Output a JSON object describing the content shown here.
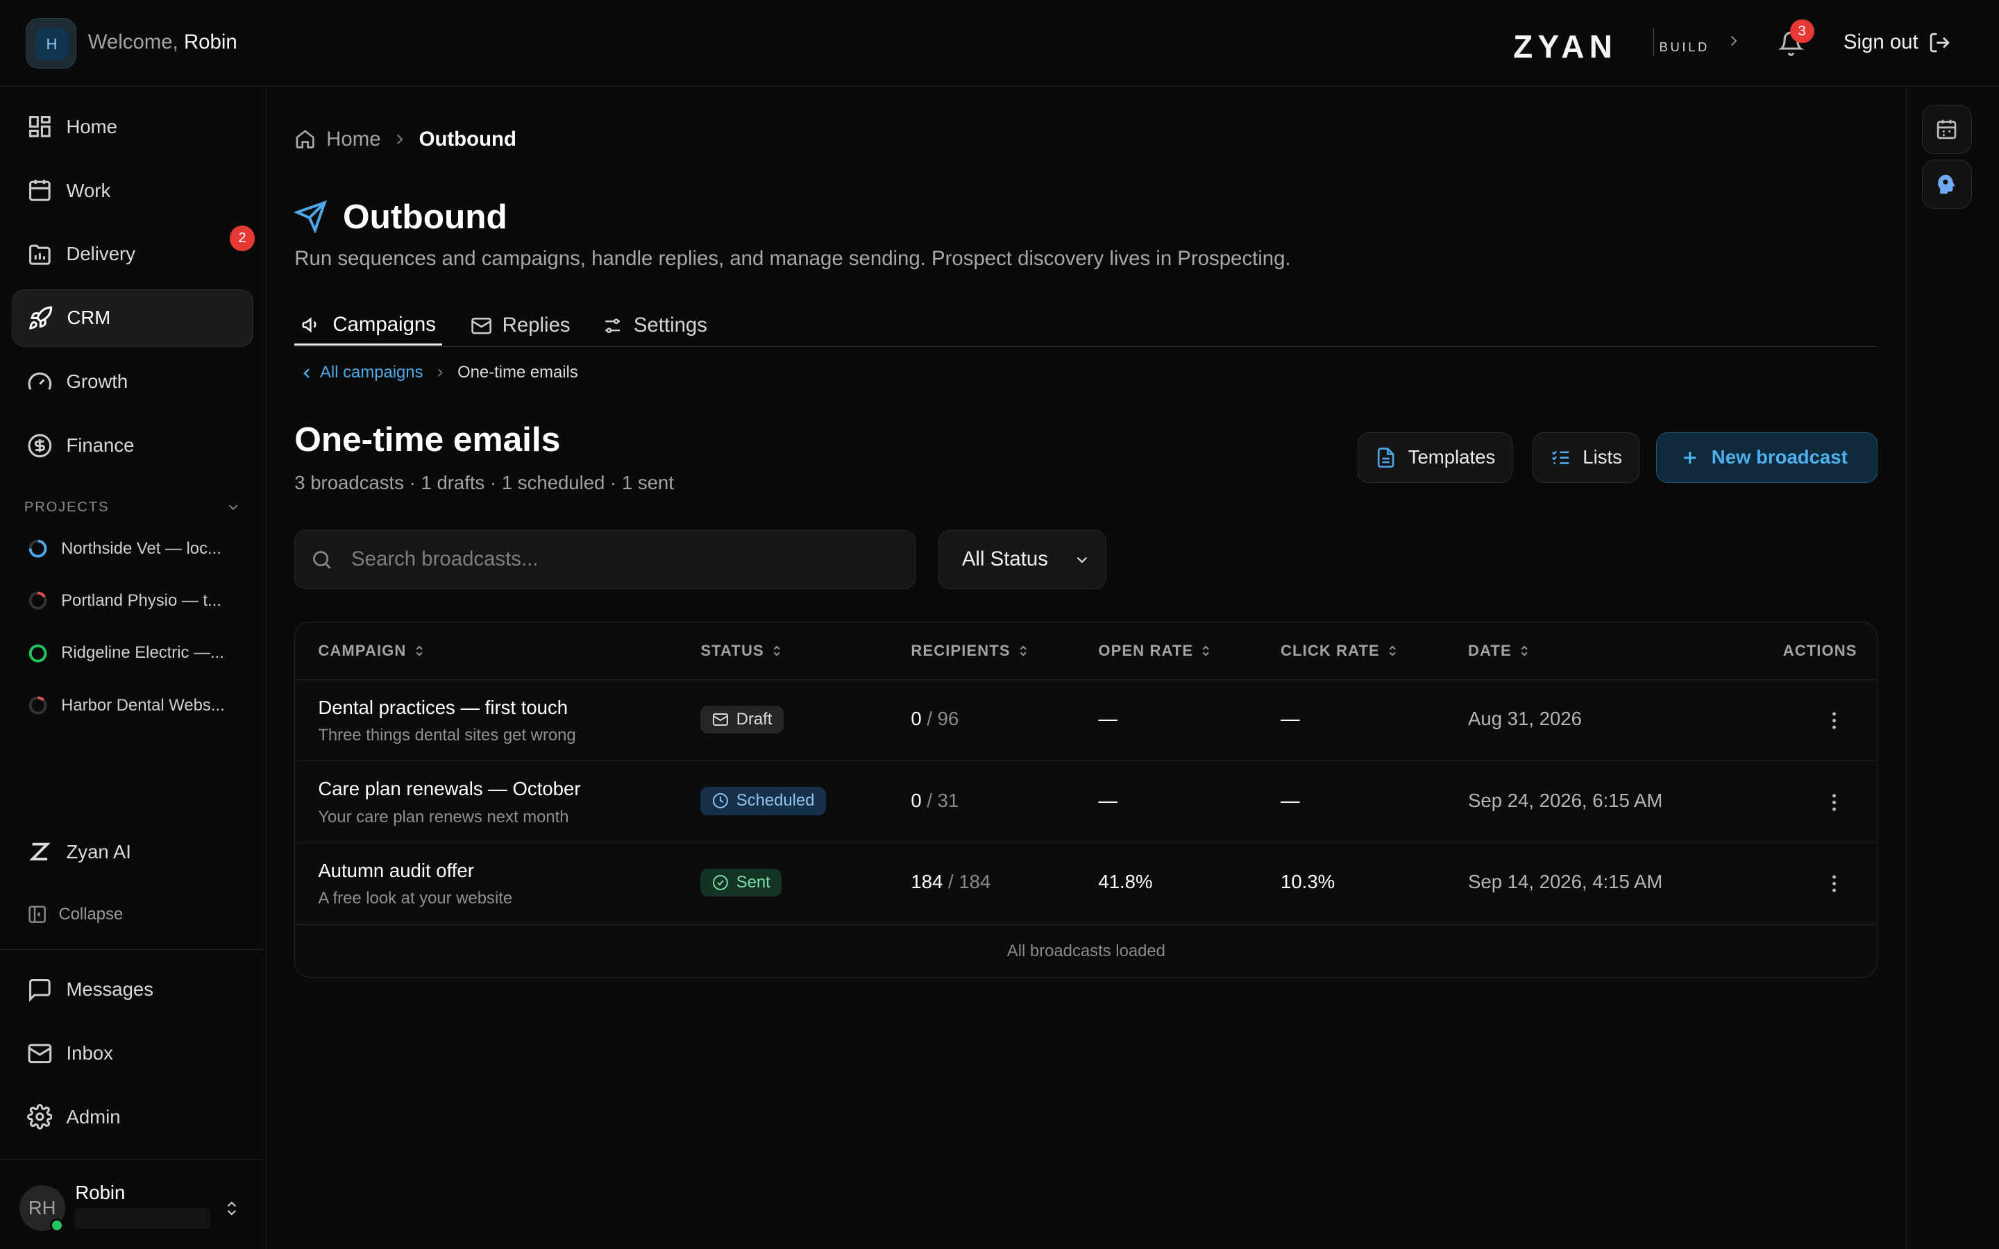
{
  "header": {
    "avatar_initial": "H",
    "welcome_prefix": "Welcome,",
    "welcome_name": "Robin",
    "logo_text": "ZYAN",
    "logo_sub": "BUILD",
    "notification_count": "3",
    "signout_label": "Sign out"
  },
  "sidebar": {
    "nav": [
      {
        "label": "Home",
        "icon": "grid-icon"
      },
      {
        "label": "Work",
        "icon": "calendar-icon"
      },
      {
        "label": "Delivery",
        "icon": "folder-chart-icon",
        "badge": "2"
      },
      {
        "label": "CRM",
        "icon": "rocket-icon",
        "active": true
      },
      {
        "label": "Growth",
        "icon": "gauge-icon"
      },
      {
        "label": "Finance",
        "icon": "dollar-circle-icon"
      }
    ],
    "projects_heading": "PROJECTS",
    "projects": [
      {
        "label": "Northside Vet — loc...",
        "ring_color": "#4ea8e8"
      },
      {
        "label": "Portland Physio — t...",
        "ring_color": "#ef5350"
      },
      {
        "label": "Ridgeline Electric —...",
        "ring_color": "#22c55e"
      },
      {
        "label": "Harbor Dental Webs...",
        "ring_color": "#ef5350"
      }
    ],
    "zyan_ai": "Zyan AI",
    "collapse": "Collapse",
    "bottom_nav": [
      {
        "label": "Messages",
        "icon": "message-icon"
      },
      {
        "label": "Inbox",
        "icon": "mail-icon"
      },
      {
        "label": "Admin",
        "icon": "gear-icon"
      }
    ],
    "user": {
      "initials": "RH",
      "name": "Robin",
      "status_color": "#22c55e"
    }
  },
  "breadcrumb": {
    "home": "Home",
    "current": "Outbound"
  },
  "page": {
    "title": "Outbound",
    "subtitle": "Run sequences and campaigns, handle replies, and manage sending. Prospect discovery lives in Prospecting."
  },
  "tabs": [
    {
      "label": "Campaigns",
      "active": true
    },
    {
      "label": "Replies"
    },
    {
      "label": "Settings"
    }
  ],
  "subcrumb": {
    "back": "All campaigns",
    "current": "One-time emails"
  },
  "section": {
    "title": "One-time emails",
    "summary": "3 broadcasts · 1 drafts · 1 scheduled · 1 sent",
    "templates_btn": "Templates",
    "lists_btn": "Lists",
    "new_btn": "New broadcast"
  },
  "filters": {
    "search_placeholder": "Search broadcasts...",
    "status_value": "All Status"
  },
  "table": {
    "columns": [
      "CAMPAIGN",
      "STATUS",
      "RECIPIENTS",
      "OPEN RATE",
      "CLICK RATE",
      "DATE",
      "ACTIONS"
    ],
    "rows": [
      {
        "name": "Dental practices — first touch",
        "subject": "Three things dental sites get wrong",
        "status": "Draft",
        "rec": "0",
        "rec_total": "/ 96",
        "open": "—",
        "click": "—",
        "date": "Aug 31, 2026"
      },
      {
        "name": "Care plan renewals — October",
        "subject": "Your care plan renews next month",
        "status": "Scheduled",
        "rec": "0",
        "rec_total": "/ 31",
        "open": "—",
        "click": "—",
        "date": "Sep 24, 2026, 6:15 AM"
      },
      {
        "name": "Autumn audit offer",
        "subject": "A free look at your website",
        "status": "Sent",
        "rec": "184",
        "rec_total": "/ 184",
        "open": "41.8%",
        "click": "10.3%",
        "date": "Sep 14, 2026, 4:15 AM"
      }
    ],
    "footer": "All broadcasts loaded"
  },
  "colors": {
    "accent": "#4ea8e8",
    "danger": "#e53935",
    "success": "#22c55e"
  }
}
